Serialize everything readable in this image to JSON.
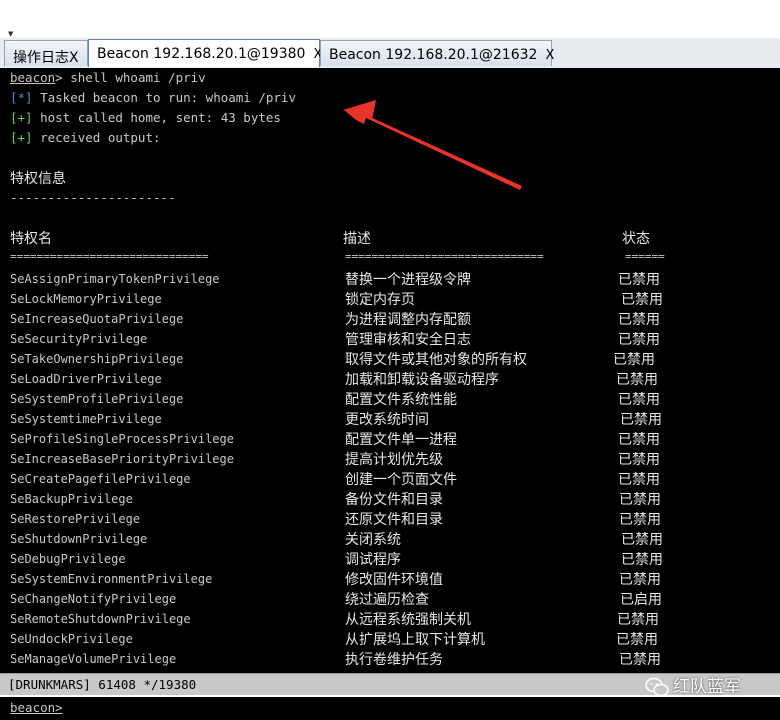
{
  "tabs": [
    {
      "label": "操作日志X",
      "close": ""
    },
    {
      "label": "Beacon 192.168.20.1@19380",
      "close": "X"
    },
    {
      "label": "Beacon 192.168.20.1@21632",
      "close": "X"
    }
  ],
  "terminal": {
    "prompt": "beacon",
    "command": "> shell whoami /priv",
    "lines": [
      {
        "tag": "[*]",
        "text": " Tasked beacon to run: whoami /priv"
      },
      {
        "tag": "[+]",
        "text": " host called home, sent: 43 bytes"
      },
      {
        "tag": "[+]",
        "text": " received output:"
      }
    ],
    "section_title": "特权信息",
    "section_rule": "----------------------",
    "col_priv": "特权名",
    "col_desc": "描述",
    "col_state": "状态",
    "rule_priv": "==============================",
    "rule_desc": "==============================",
    "rule_state": "======",
    "rows": [
      {
        "name": "SeAssignPrimaryTokenPrivilege",
        "desc": "替换一个进程级令牌",
        "state": "已禁用"
      },
      {
        "name": "SeLockMemoryPrivilege",
        "desc": "锁定内存页",
        "state": "已禁用"
      },
      {
        "name": "SeIncreaseQuotaPrivilege",
        "desc": "为进程调整内存配额",
        "state": "已禁用"
      },
      {
        "name": "SeSecurityPrivilege",
        "desc": "管理审核和安全日志",
        "state": "已禁用"
      },
      {
        "name": "SeTakeOwnershipPrivilege",
        "desc": "取得文件或其他对象的所有权",
        "state": "已禁用"
      },
      {
        "name": "SeLoadDriverPrivilege",
        "desc": "加载和卸载设备驱动程序",
        "state": "已禁用"
      },
      {
        "name": "SeSystemProfilePrivilege",
        "desc": "配置文件系统性能",
        "state": "已禁用"
      },
      {
        "name": "SeSystemtimePrivilege",
        "desc": "更改系统时间",
        "state": "已禁用"
      },
      {
        "name": "SeProfileSingleProcessPrivilege",
        "desc": "配置文件单一进程",
        "state": "已禁用"
      },
      {
        "name": "SeIncreaseBasePriorityPrivilege",
        "desc": "提高计划优先级",
        "state": "已禁用"
      },
      {
        "name": "SeCreatePagefilePrivilege",
        "desc": "创建一个页面文件",
        "state": "已禁用"
      },
      {
        "name": "SeBackupPrivilege",
        "desc": "备份文件和目录",
        "state": "已禁用"
      },
      {
        "name": "SeRestorePrivilege",
        "desc": "还原文件和目录",
        "state": "已禁用"
      },
      {
        "name": "SeShutdownPrivilege",
        "desc": "关闭系统",
        "state": "已禁用"
      },
      {
        "name": "SeDebugPrivilege",
        "desc": "调试程序",
        "state": "已禁用"
      },
      {
        "name": "SeSystemEnvironmentPrivilege",
        "desc": "修改固件环境值",
        "state": "已禁用"
      },
      {
        "name": "SeChangeNotifyPrivilege",
        "desc": "绕过遍历检查",
        "state": "已启用"
      },
      {
        "name": "SeRemoteShutdownPrivilege",
        "desc": "从远程系统强制关机",
        "state": "已禁用"
      },
      {
        "name": "SeUndockPrivilege",
        "desc": "从扩展坞上取下计算机",
        "state": "已禁用"
      },
      {
        "name": "SeManageVolumePrivilege",
        "desc": "执行卷维护任务",
        "state": "已禁用"
      }
    ]
  },
  "statusbar": {
    "text": "[DRUNKMARS] 61408 */19380"
  },
  "input": {
    "prompt": "beacon>"
  },
  "watermark": {
    "text": "红队蓝军",
    "icon": "wechat-icon"
  },
  "colors": {
    "tag_blue": "#5a88d8",
    "tag_green": "#6fcf4f",
    "arrow_red": "#e8332a",
    "terminal_bg": "#000000"
  }
}
